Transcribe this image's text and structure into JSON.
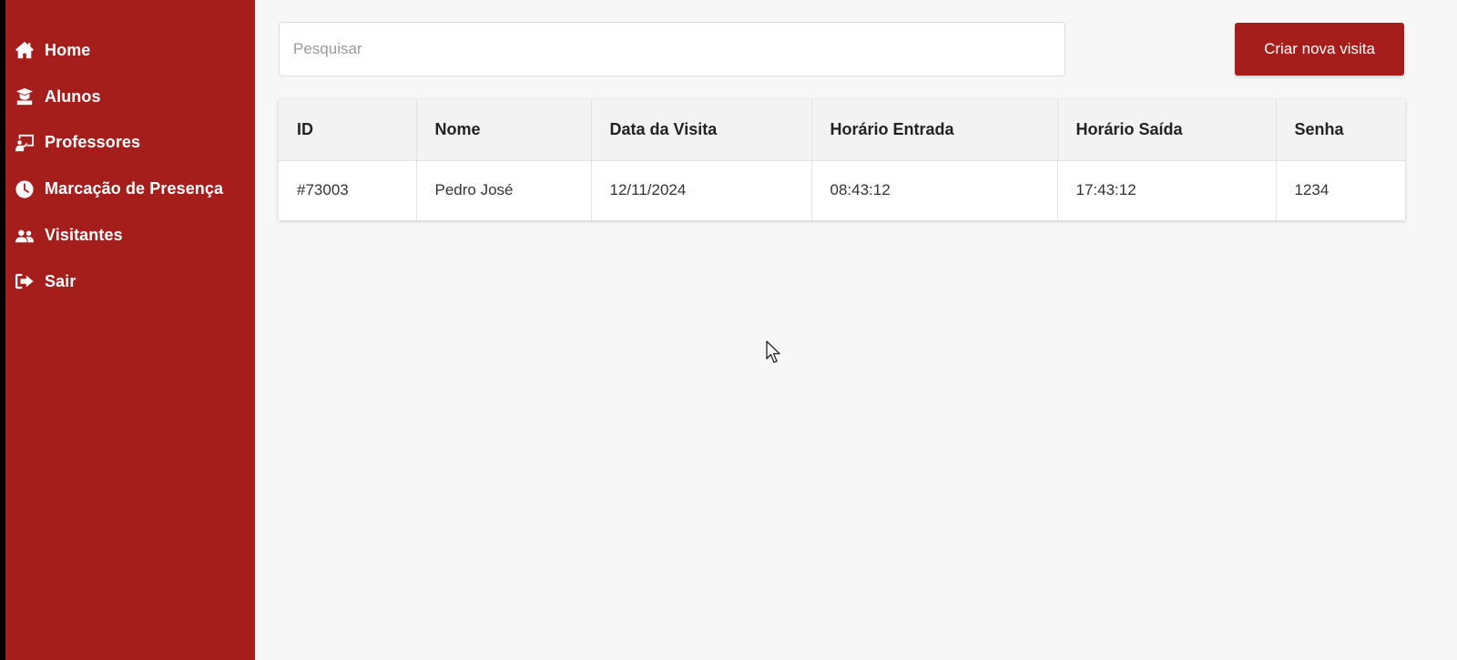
{
  "sidebar": {
    "items": [
      {
        "label": "Home",
        "icon": "home-icon"
      },
      {
        "label": "Alunos",
        "icon": "student-icon"
      },
      {
        "label": "Professores",
        "icon": "teacher-icon"
      },
      {
        "label": "Marcação de Presença",
        "icon": "clock-icon"
      },
      {
        "label": "Visitantes",
        "icon": "users-icon"
      },
      {
        "label": "Sair",
        "icon": "sign-out-icon"
      }
    ]
  },
  "search": {
    "placeholder": "Pesquisar",
    "value": ""
  },
  "toolbar": {
    "create_label": "Criar nova visita"
  },
  "table": {
    "headers": [
      "ID",
      "Nome",
      "Data da Visita",
      "Horário Entrada",
      "Horário Saída",
      "Senha"
    ],
    "rows": [
      [
        "#73003",
        "Pedro José",
        "12/11/2024",
        "08:43:12",
        "17:43:12",
        "1234"
      ]
    ]
  },
  "colors": {
    "brand": "#a51e1c",
    "background": "#f7f7f7"
  }
}
